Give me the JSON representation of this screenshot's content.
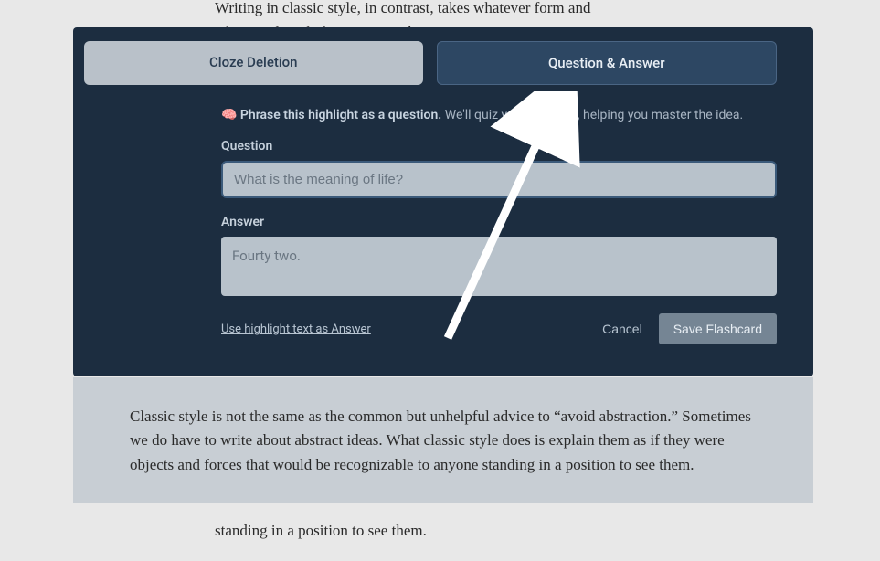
{
  "background": {
    "text_top": "Writing in classic style, in contrast, takes whatever form and whatever length the writer needs to present an interesting",
    "text_bottom": "standing in a position to see them."
  },
  "overlay": {
    "tabs": {
      "cloze": "Cloze Deletion",
      "qa": "Question & Answer"
    },
    "instruction": {
      "emoji": "🧠",
      "bold": "Phrase this highlight as a question.",
      "rest": "We'll quiz you on it later, helping you master the idea."
    },
    "question": {
      "label": "Question",
      "placeholder": "What is the meaning of life?"
    },
    "answer": {
      "label": "Answer",
      "placeholder": "Fourty two."
    },
    "use_highlight": "Use highlight text as Answer",
    "cancel": "Cancel",
    "save": "Save Flashcard"
  },
  "quote": "Classic style is not the same as the common but unhelpful advice to “avoid abstraction.” Sometimes we do have to write about abstract ideas. What classic style does is explain them as if they were objects and forces that would be recognizable to anyone standing in a position to see them."
}
